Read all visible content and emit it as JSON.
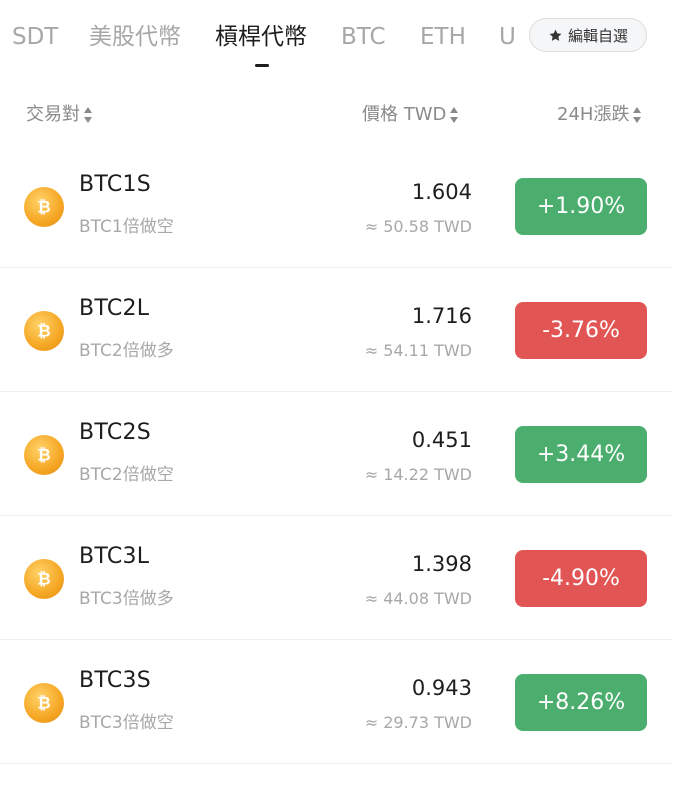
{
  "tabs": [
    {
      "label": "SDT",
      "active": false
    },
    {
      "label": "美股代幣",
      "active": false
    },
    {
      "label": "槓桿代幣",
      "active": true
    },
    {
      "label": "BTC",
      "active": false
    },
    {
      "label": "ETH",
      "active": false
    },
    {
      "label": "U",
      "active": false
    }
  ],
  "edit_button": {
    "label": "編輯自選",
    "icon": "star-icon"
  },
  "header": {
    "pair": "交易對",
    "price": "價格 TWD",
    "change": "24H漲跌"
  },
  "colors": {
    "up": "#4cae6e",
    "down": "#e25555",
    "coin": "#f5a623"
  },
  "rows": [
    {
      "symbol": "BTC1S",
      "desc": "BTC1倍做空",
      "price": "1.604",
      "twd": "≈ 50.58 TWD",
      "change": "+1.90%",
      "direction": "up",
      "icon": "bitcoin-icon"
    },
    {
      "symbol": "BTC2L",
      "desc": "BTC2倍做多",
      "price": "1.716",
      "twd": "≈ 54.11 TWD",
      "change": "-3.76%",
      "direction": "down",
      "icon": "bitcoin-icon"
    },
    {
      "symbol": "BTC2S",
      "desc": "BTC2倍做空",
      "price": "0.451",
      "twd": "≈ 14.22 TWD",
      "change": "+3.44%",
      "direction": "up",
      "icon": "bitcoin-icon"
    },
    {
      "symbol": "BTC3L",
      "desc": "BTC3倍做多",
      "price": "1.398",
      "twd": "≈ 44.08 TWD",
      "change": "-4.90%",
      "direction": "down",
      "icon": "bitcoin-icon"
    },
    {
      "symbol": "BTC3S",
      "desc": "BTC3倍做空",
      "price": "0.943",
      "twd": "≈ 29.73 TWD",
      "change": "+8.26%",
      "direction": "up",
      "icon": "bitcoin-icon"
    }
  ]
}
